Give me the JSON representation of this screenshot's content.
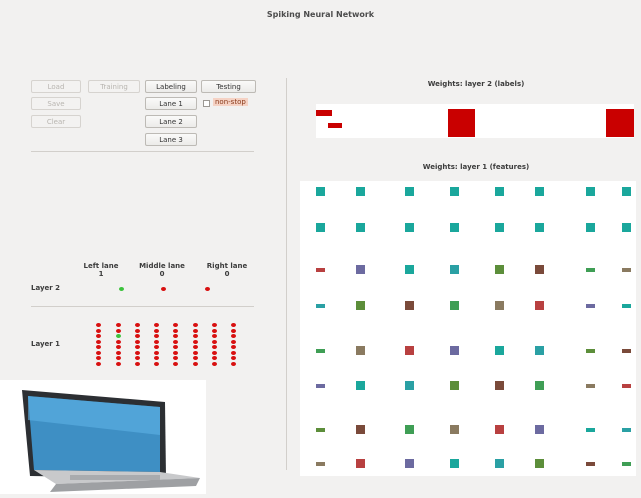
{
  "window": {
    "title": "Spiking Neural Network"
  },
  "controls": {
    "load": "Load",
    "training": "Training",
    "labeling": "Labeling",
    "testing": "Testing",
    "save": "Save",
    "clear": "Clear",
    "lane1": "Lane 1",
    "lane2": "Lane 2",
    "lane3": "Lane 3",
    "nonstop": "non-stop"
  },
  "output": {
    "lanes": [
      {
        "name": "Left lane",
        "value": "1"
      },
      {
        "name": "Middle lane",
        "value": "0"
      },
      {
        "name": "Right lane",
        "value": "0"
      }
    ],
    "layer2_label": "Layer 2",
    "layer1_label": "Layer 1"
  },
  "weights": {
    "layer2_title": "Weights: layer 2 (labels)",
    "layer1_title": "Weights: layer 1 (features)"
  },
  "colors": {
    "spike_green": "#3cc23c",
    "neuron_red": "#d81010",
    "weight_red": "#c90000",
    "teal": "#1aa79c"
  },
  "icons": {
    "laptop": "laptop-illustration"
  }
}
